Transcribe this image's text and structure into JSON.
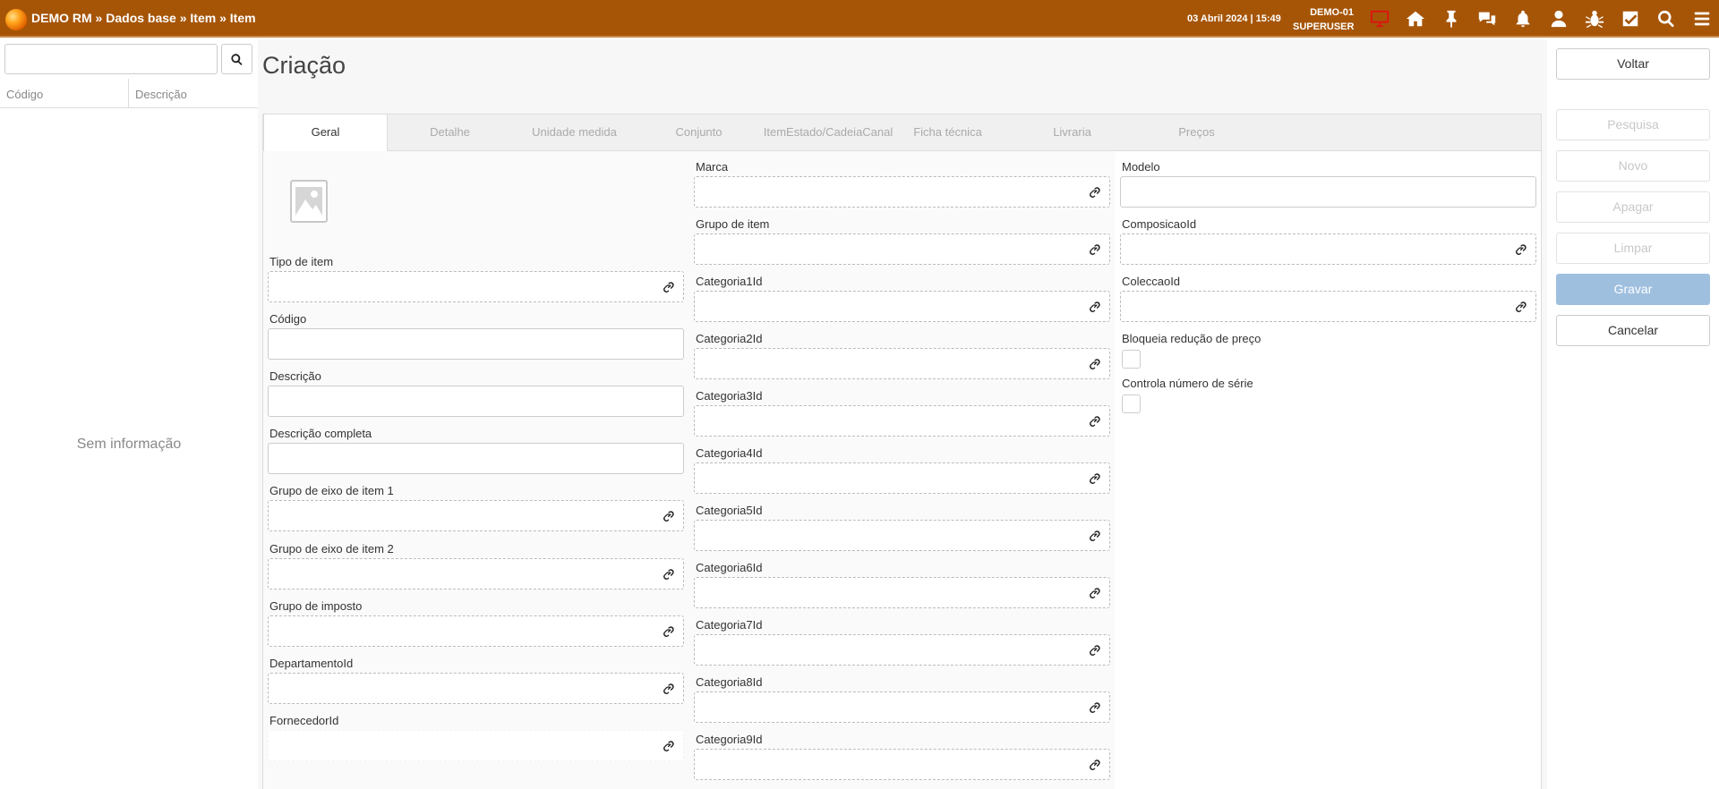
{
  "header": {
    "breadcrumb": [
      "DEMO RM",
      "Dados base",
      "Item",
      "Item"
    ],
    "separator": " » ",
    "datetime": "03 Abril 2024 | 15:49",
    "company": "DEMO-01",
    "user": "SUPERUSER",
    "icons": [
      "monitor-icon",
      "home-icon",
      "pin-icon",
      "chat-icon",
      "bell-icon",
      "user-icon",
      "bug-icon",
      "checkbox-icon",
      "search-icon",
      "menu-icon"
    ]
  },
  "left_panel": {
    "search_placeholder": "",
    "columns": [
      "Código",
      "Descrição"
    ],
    "empty_text": "Sem informação"
  },
  "page": {
    "title": "Criação"
  },
  "tabs": [
    {
      "label": "Geral",
      "active": true
    },
    {
      "label": "Detalhe",
      "active": false
    },
    {
      "label": "Unidade medida",
      "active": false
    },
    {
      "label": "Conjunto",
      "active": false
    },
    {
      "label": "ItemEstado/CadeiaCanal",
      "active": false
    },
    {
      "label": "Ficha técnica",
      "active": false
    },
    {
      "label": "Livraria",
      "active": false
    },
    {
      "label": "Preços",
      "active": false
    }
  ],
  "form": {
    "col1": [
      {
        "label": "Tipo de item",
        "lookup": true
      },
      {
        "label": "Código",
        "lookup": false
      },
      {
        "label": "Descrição",
        "lookup": false
      },
      {
        "label": "Descrição completa",
        "lookup": false
      },
      {
        "label": "Grupo de eixo de item 1",
        "lookup": true
      },
      {
        "label": "Grupo de eixo de item 2",
        "lookup": true
      },
      {
        "label": "Grupo de imposto",
        "lookup": true
      },
      {
        "label": "DepartamentoId",
        "lookup": true
      },
      {
        "label": "FornecedorId",
        "lookup": true
      }
    ],
    "col2": [
      {
        "label": "Marca",
        "lookup": true
      },
      {
        "label": "Grupo de item",
        "lookup": true
      },
      {
        "label": "Categoria1Id",
        "lookup": true
      },
      {
        "label": "Categoria2Id",
        "lookup": true
      },
      {
        "label": "Categoria3Id",
        "lookup": true
      },
      {
        "label": "Categoria4Id",
        "lookup": true
      },
      {
        "label": "Categoria5Id",
        "lookup": true
      },
      {
        "label": "Categoria6Id",
        "lookup": true
      },
      {
        "label": "Categoria7Id",
        "lookup": true
      },
      {
        "label": "Categoria8Id",
        "lookup": true
      },
      {
        "label": "Categoria9Id",
        "lookup": true
      }
    ],
    "col3": [
      {
        "label": "Modelo",
        "lookup": false
      },
      {
        "label": "ComposicaoId",
        "lookup": true
      },
      {
        "label": "ColeccaoId",
        "lookup": true
      }
    ],
    "checkboxes": [
      {
        "label": "Bloqueia redução de preço",
        "checked": false
      },
      {
        "label": "Controla número de série",
        "checked": false
      }
    ]
  },
  "actions": {
    "back": "Voltar",
    "search": "Pesquisa",
    "new": "Novo",
    "delete": "Apagar",
    "clear": "Limpar",
    "save": "Gravar",
    "cancel": "Cancelar"
  },
  "colors": {
    "topbar": "#a65507",
    "primary_button": "#9fbfdf"
  }
}
